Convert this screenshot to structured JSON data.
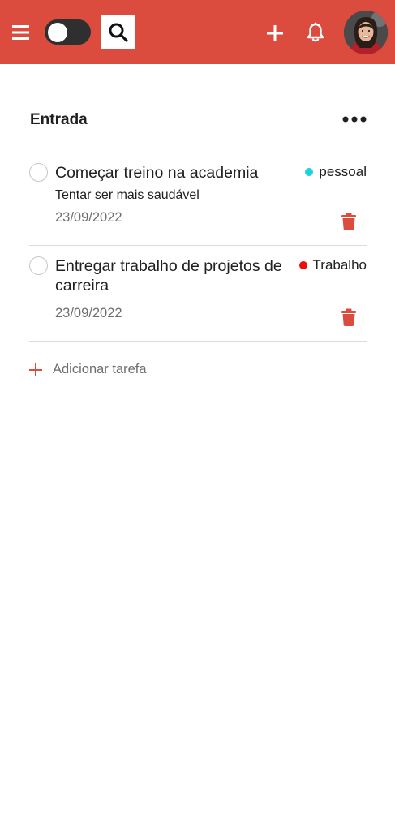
{
  "header": {
    "background": "#db4c3f",
    "menu_icon": "menu-icon",
    "toggle_state": "off",
    "search_icon": "search-icon",
    "add_icon": "plus-icon",
    "notifications_icon": "bell-icon",
    "avatar": "user-avatar"
  },
  "project": {
    "title": "Entrada",
    "more_icon": "more-horizontal-icon"
  },
  "tasks": [
    {
      "title": "Começar treino na academia",
      "description": "Tentar ser mais saudável",
      "date": "23/09/2022",
      "tag": {
        "label": "pessoal",
        "color": "#1bd3de"
      },
      "delete_icon": "trash-icon"
    },
    {
      "title": "Entregar trabalho de projetos de carreira",
      "description": "",
      "date": "23/09/2022",
      "tag": {
        "label": "Trabalho",
        "color": "#f10c0c"
      },
      "delete_icon": "trash-icon"
    }
  ],
  "add_task": {
    "label": "Adicionar tarefa",
    "color": "#db4c3f"
  }
}
